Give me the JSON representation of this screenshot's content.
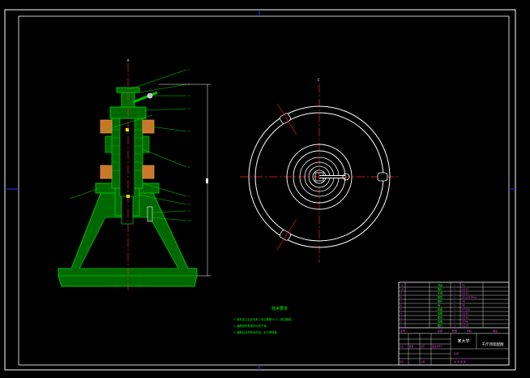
{
  "sheet": {
    "colors": {
      "background": "#000000",
      "frame": "#ffffff",
      "part": "#00c000",
      "part_fill": "#006800",
      "centerline": "#ff2020",
      "leader": "#00d000",
      "dimension": "#ffffff",
      "title_block_text": "#ff40ff",
      "highlight": "#ffff00"
    }
  },
  "front_view": {
    "section_mark": "A",
    "balloons": [
      "1",
      "2",
      "3",
      "4",
      "5",
      "6",
      "7",
      "8",
      "9",
      "10",
      "11"
    ],
    "left_balloon": "12"
  },
  "top_view": {
    "section_mark": "C"
  },
  "notes": {
    "heading": "技术要求",
    "lines": [
      "1. 零件加工后去毛刺，未注倒角C0.5，锐边倒钝。",
      "2. 装配前所有零件清洗干净。",
      "3. 装配后丝杆转动灵活，无卡滞现象。"
    ]
  },
  "title_block": {
    "drawing_title": "千斤顶装配图",
    "school": "某大学",
    "scale_label": "比例",
    "sheet_label": "共 张 第 张",
    "parts_rows": [
      [
        "11",
        "顶盖",
        "1",
        "45"
      ],
      [
        "10",
        "螺钉",
        "1",
        "Q235"
      ],
      [
        "9",
        "手柄",
        "1",
        "Q235"
      ],
      [
        "8",
        "螺套",
        "1",
        "ZCuAl10Fe3"
      ],
      [
        "7",
        "螺杆",
        "1",
        "45"
      ],
      [
        "6",
        "销",
        "1",
        "45"
      ],
      [
        "5",
        "底座",
        "1",
        "HT200"
      ],
      [
        "4",
        "垫圈",
        "1",
        "Q235"
      ],
      [
        "3",
        "螺母",
        "1",
        "Q235"
      ],
      [
        "2",
        "挡圈",
        "1",
        "65Mn"
      ],
      [
        "1",
        "螺钉",
        "2",
        "Q235"
      ]
    ],
    "header_row": [
      "序号",
      "名称",
      "数量",
      "材料",
      "备注"
    ],
    "revision_row": [
      "标记",
      "处数",
      "分区",
      "更改文件号",
      "签名",
      "日期"
    ]
  }
}
